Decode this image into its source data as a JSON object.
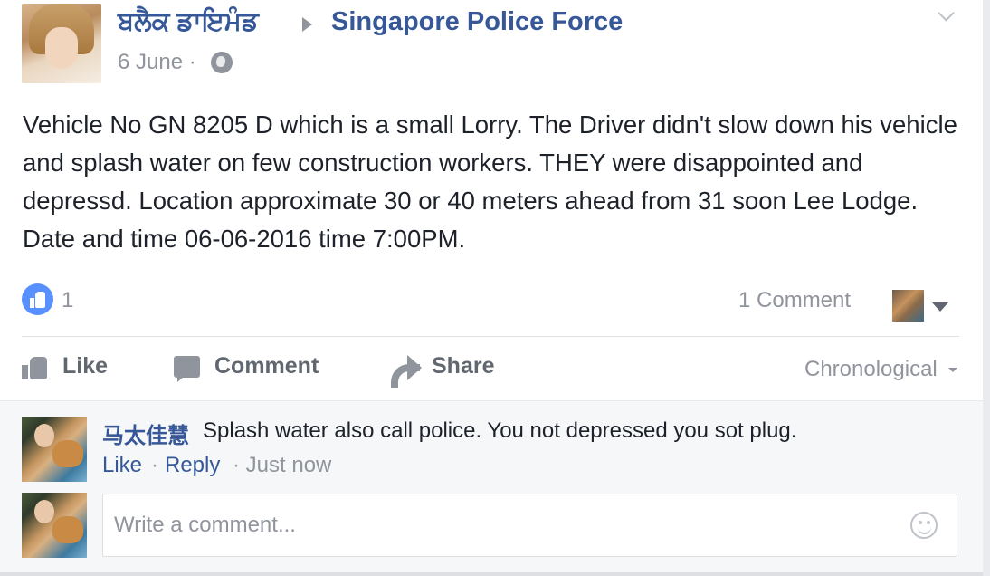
{
  "post": {
    "author": "ਬਲੈਕ ਡਾਇਮੰਡ",
    "target_page": "Singapore Police Force",
    "date": "6 June ·",
    "privacy_icon": "globe-icon",
    "body": "Vehicle No GN 8205 D which is a small Lorry. The Driver didn't slow down his vehicle and splash water on few construction workers. THEY were disappointed and depressd. Location approximate 30 or 40 meters ahead from 31 soon Lee Lodge. Date and time 06-06-2016 time 7:00PM.",
    "like_count": "1",
    "comment_count": "1 Comment"
  },
  "actions": {
    "like": "Like",
    "comment": "Comment",
    "share": "Share",
    "sort": "Chronological"
  },
  "comments": [
    {
      "author": "马太佳慧",
      "text": "Splash water also call police. You not depressed you sot plug.",
      "like": "Like",
      "reply": "Reply",
      "separator": "·",
      "time": "· Just now"
    }
  ],
  "composer": {
    "placeholder": "Write a comment..."
  },
  "colors": {
    "link": "#365899",
    "muted": "#90949c",
    "like_blue": "#5890ff",
    "comments_bg": "#f6f7f9"
  }
}
